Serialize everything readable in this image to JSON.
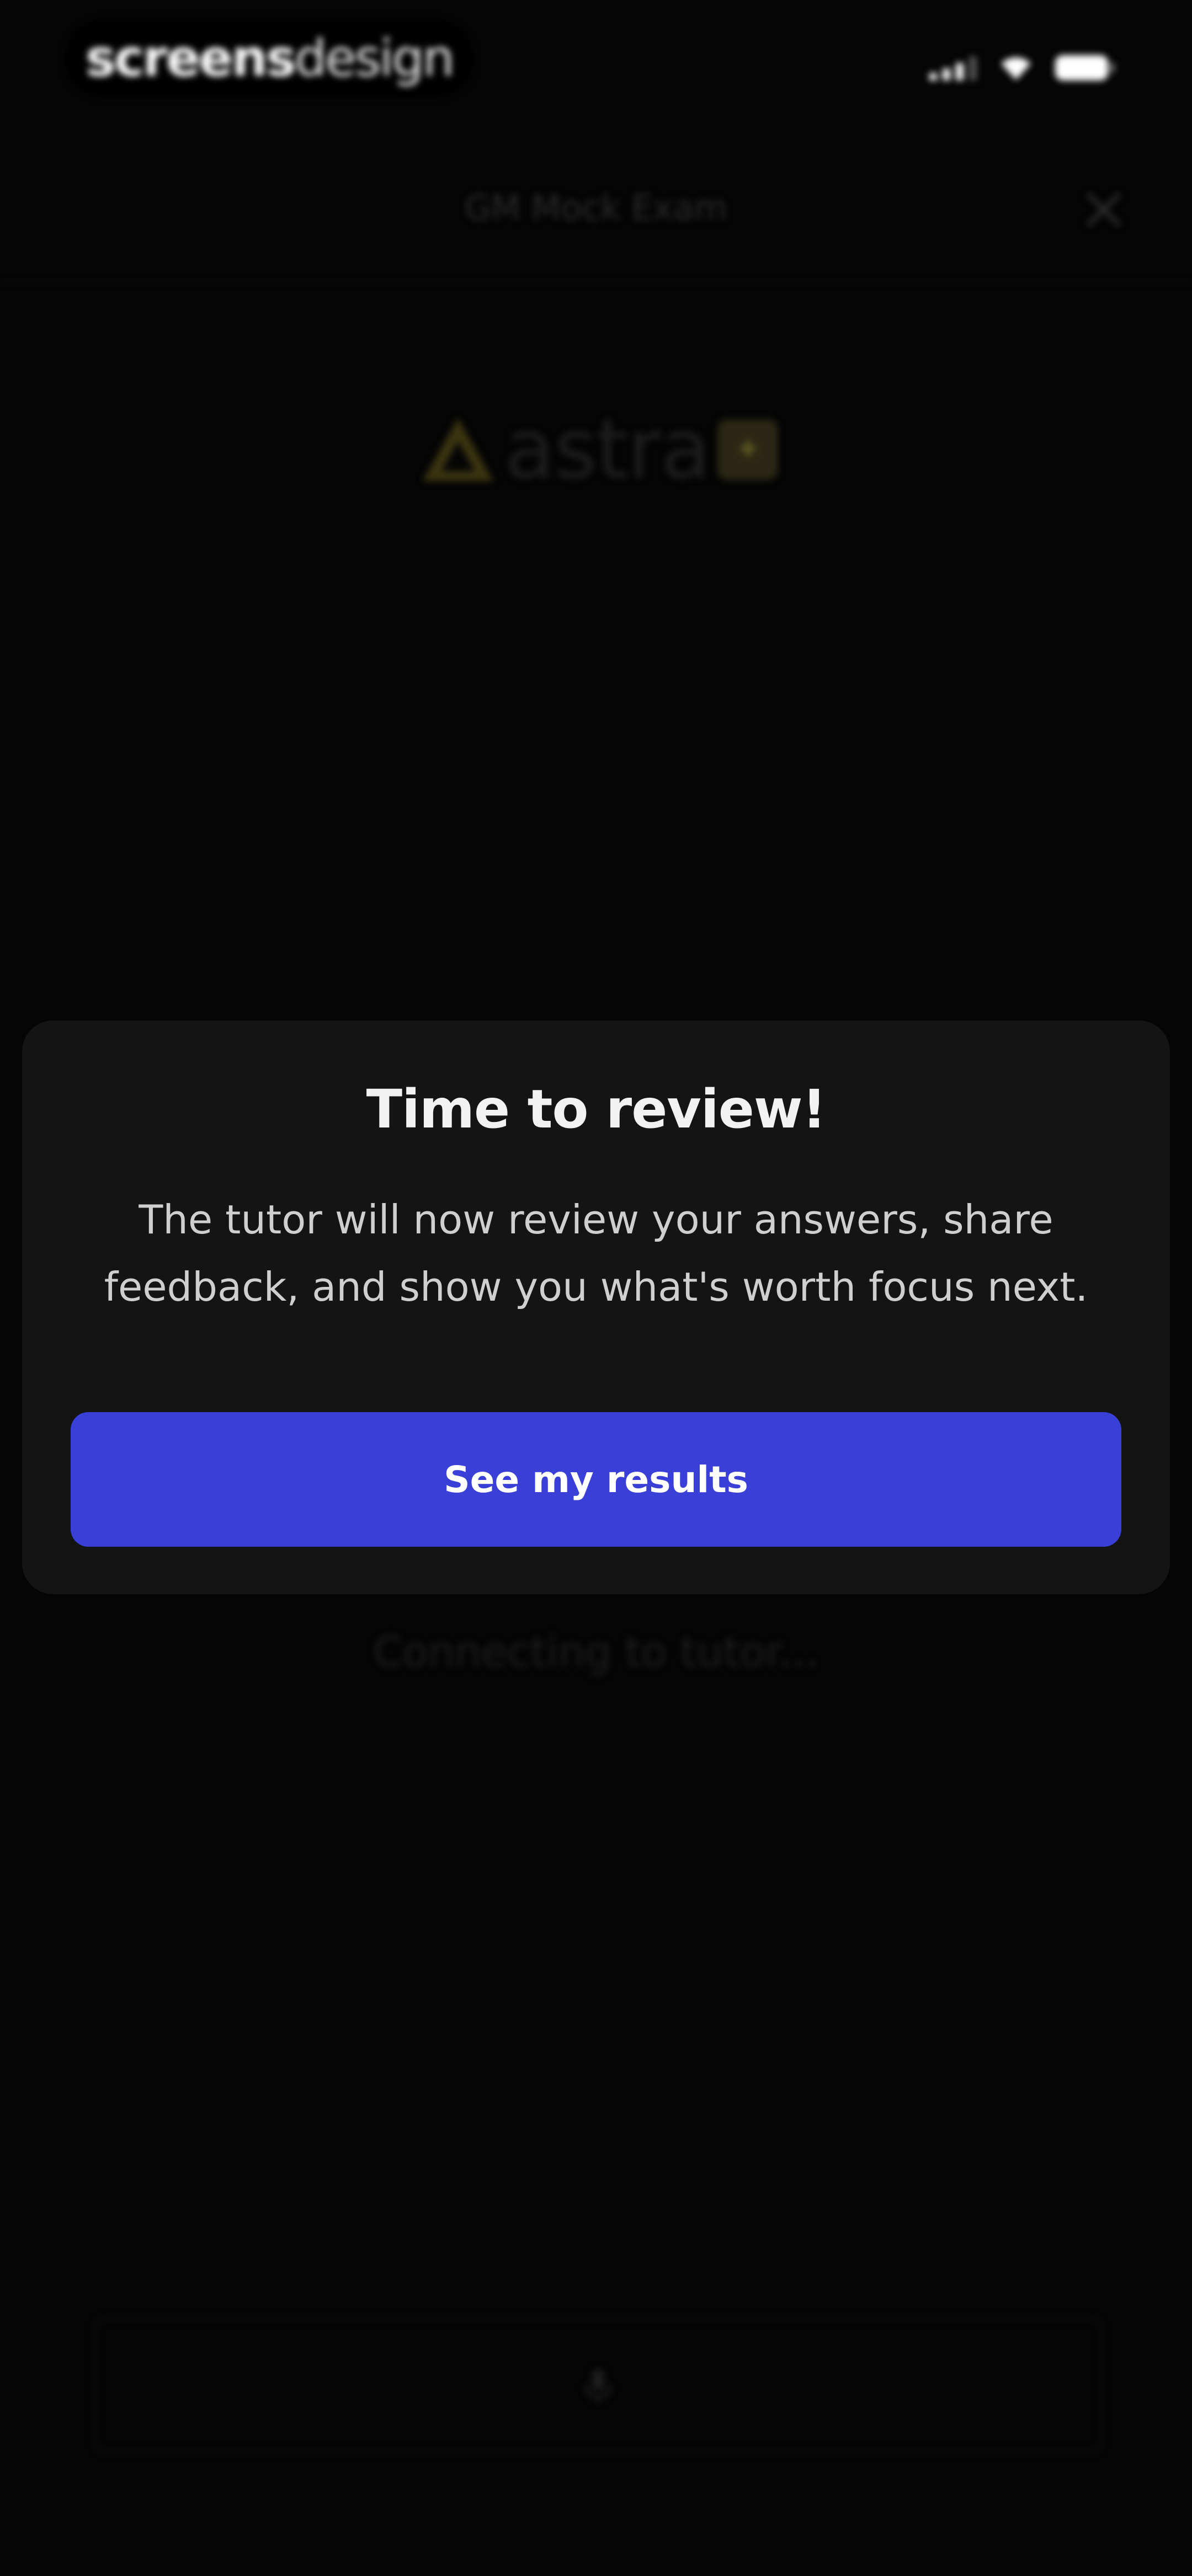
{
  "status_bar": {
    "brand_bold": "screens",
    "brand_light": "design"
  },
  "background": {
    "nav_title": "GM Mock Exam",
    "logo_text": "astra",
    "connecting_text": "Connecting to tutor..."
  },
  "modal": {
    "title": "Time to review!",
    "body": "The tutor will now review your answers, share feedback, and show you what's worth focus next.",
    "button_label": "See my results"
  },
  "colors": {
    "background": "#050505",
    "modal_background": "#141414",
    "primary_button": "#3a3fd8",
    "logo_accent": "#b59a16"
  },
  "icons": {
    "status": [
      "signal-icon",
      "wifi-icon",
      "battery-icon"
    ],
    "nav_close": "close-icon",
    "input": "mic-icon"
  }
}
